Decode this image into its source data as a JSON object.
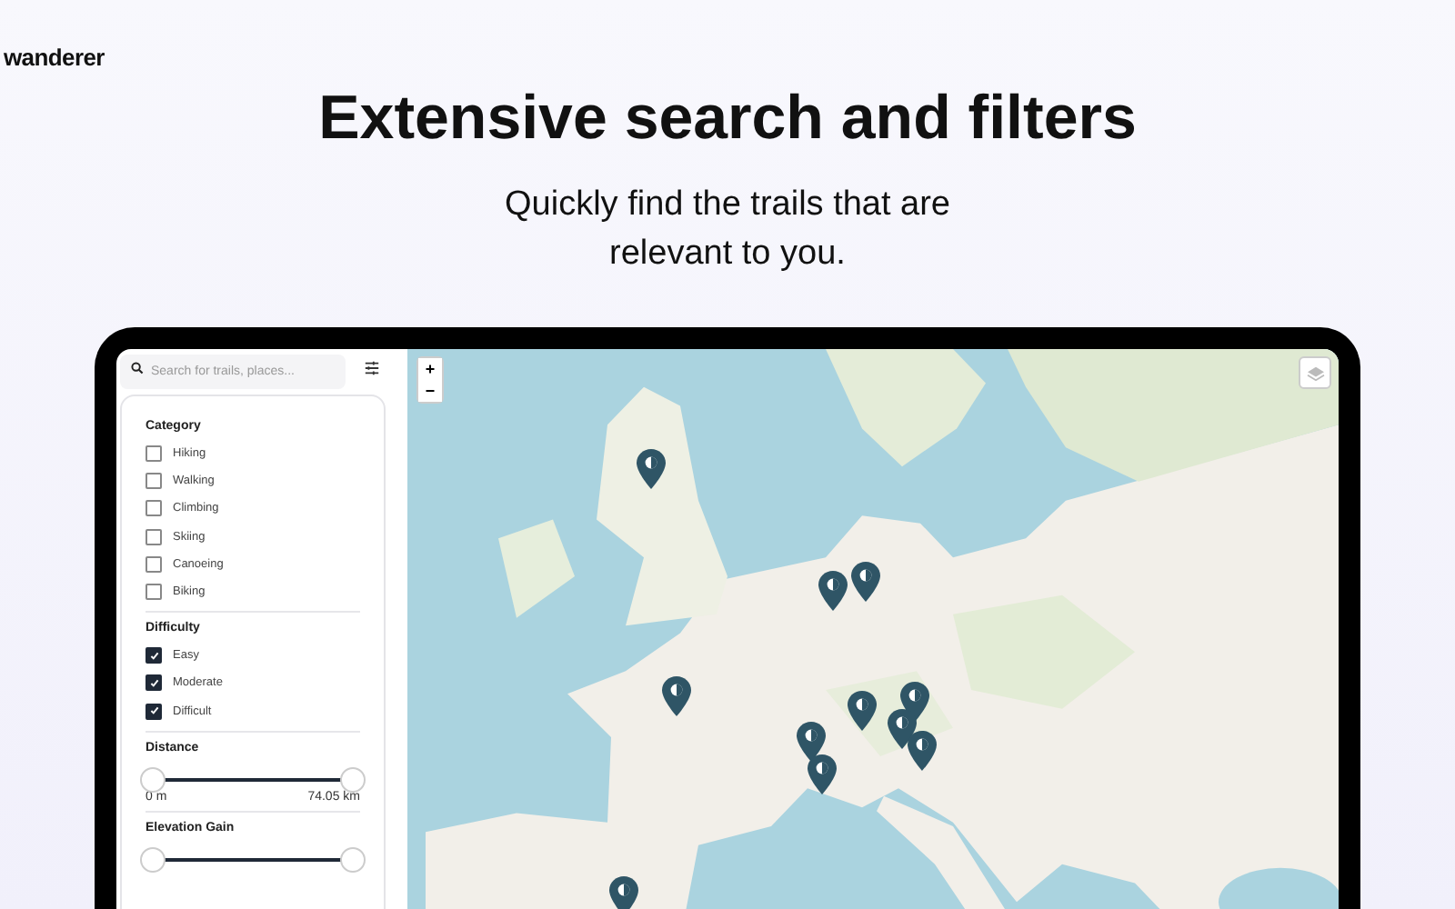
{
  "brand": "wanderer",
  "hero": {
    "title": "Extensive search and filters",
    "subtitle": "Quickly find the trails that are relevant to you."
  },
  "search": {
    "placeholder": "Search for trails, places..."
  },
  "filters": [
    {
      "kind": "checks",
      "title": "Category",
      "options": [
        {
          "label": "Hiking",
          "checked": false
        },
        {
          "label": "Walking",
          "checked": false
        },
        {
          "label": "Climbing",
          "checked": false
        },
        {
          "label": "Skiing",
          "checked": false
        },
        {
          "label": "Canoeing",
          "checked": false
        },
        {
          "label": "Biking",
          "checked": false
        }
      ]
    },
    {
      "kind": "checks",
      "title": "Difficulty",
      "options": [
        {
          "label": "Easy",
          "checked": true
        },
        {
          "label": "Moderate",
          "checked": true
        },
        {
          "label": "Difficult",
          "checked": true
        }
      ]
    },
    {
      "kind": "range",
      "title": "Distance",
      "thumbs": [
        {
          "level": 0
        },
        {
          "level": 1
        }
      ],
      "min_label": "0 m",
      "max_label": "74.05 km"
    },
    {
      "kind": "range",
      "title": "Elevation Gain",
      "thumbs": [
        {
          "level": 0
        },
        {
          "level": 1
        }
      ]
    }
  ],
  "map": {
    "zoom_in": "+",
    "zoom_out": "−"
  }
}
